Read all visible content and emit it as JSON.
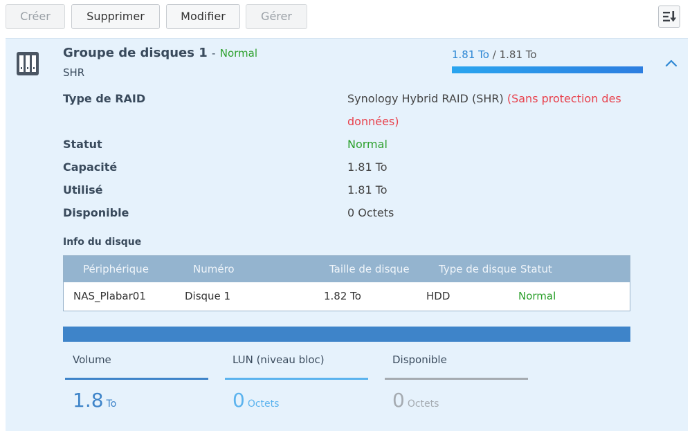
{
  "toolbar": {
    "create_label": "Créer",
    "delete_label": "Supprimer",
    "edit_label": "Modifier",
    "manage_label": "Gérer",
    "sort_icon": "sort-down-icon"
  },
  "storage_pool": {
    "title": "Groupe de disques 1",
    "title_separator": "-",
    "status": "Normal",
    "subtitle": "SHR",
    "usage_used": "1.81 To",
    "usage_separator": "/",
    "usage_total": "1.81 To",
    "usage_fraction": 1.0,
    "collapse_icon": "chevron-up-icon"
  },
  "properties": {
    "raid_type_label": "Type de RAID",
    "raid_type_value": "Synology Hybrid RAID (SHR)",
    "raid_type_warning": "(Sans protection des données)",
    "status_label": "Statut",
    "status_value": "Normal",
    "capacity_label": "Capacité",
    "capacity_value": "1.81 To",
    "used_label": "Utilisé",
    "used_value": "1.81 To",
    "available_label": "Disponible",
    "available_value": "0 Octets"
  },
  "disk_info": {
    "heading": "Info du disque",
    "columns": [
      "Périphérique",
      "Numéro",
      "Taille de disque",
      "Type de disque",
      "Statut"
    ],
    "rows": [
      [
        "NAS_Plabar01",
        "Disque 1",
        "1.82 To",
        "HDD",
        "Normal"
      ]
    ]
  },
  "allocation": {
    "items": [
      {
        "label": "Volume",
        "value": "1.8",
        "unit": "To",
        "color": "#3e84c9"
      },
      {
        "label": "LUN (niveau bloc)",
        "value": "0",
        "unit": "Octets",
        "color": "#5bb3ee"
      },
      {
        "label": "Disponible",
        "value": "0",
        "unit": "Octets",
        "color": "#a5abb1"
      }
    ]
  },
  "colors": {
    "status_green": "#2ca02c",
    "warning_red": "#e8414c",
    "accent_blue": "#2d87d4",
    "table_header": "#94b4cf"
  }
}
